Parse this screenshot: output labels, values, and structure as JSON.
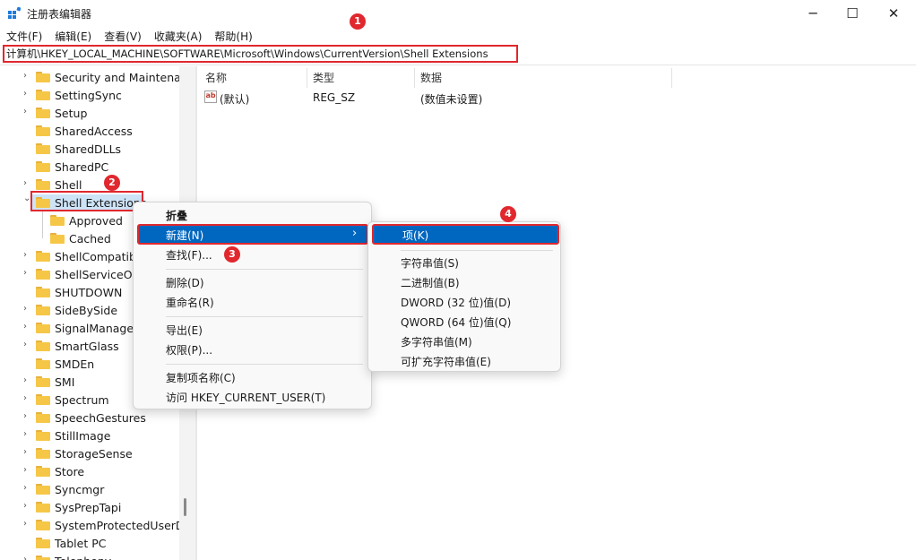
{
  "window": {
    "title": "注册表编辑器",
    "minimize_glyph": "─",
    "maximize_glyph": "☐",
    "close_glyph": "✕"
  },
  "menubar": [
    "文件(F)",
    "编辑(E)",
    "查看(V)",
    "收藏夹(A)",
    "帮助(H)"
  ],
  "address": "计算机\\HKEY_LOCAL_MACHINE\\SOFTWARE\\Microsoft\\Windows\\CurrentVersion\\Shell Extensions",
  "tree": [
    {
      "label": "Security and Maintenan",
      "expander": ">"
    },
    {
      "label": "SettingSync",
      "expander": ">"
    },
    {
      "label": "Setup",
      "expander": ">"
    },
    {
      "label": "SharedAccess",
      "expander": ""
    },
    {
      "label": "SharedDLLs",
      "expander": ""
    },
    {
      "label": "SharedPC",
      "expander": ""
    },
    {
      "label": "Shell",
      "expander": ">"
    },
    {
      "label": "Shell Extensions",
      "expander": "v",
      "selected": true
    },
    {
      "label": "Approved",
      "expander": "",
      "child": true
    },
    {
      "label": "Cached",
      "expander": "",
      "child": true
    },
    {
      "label": "ShellCompatibi",
      "expander": ">"
    },
    {
      "label": "ShellServiceOb",
      "expander": ">"
    },
    {
      "label": "SHUTDOWN",
      "expander": ""
    },
    {
      "label": "SideBySide",
      "expander": ">"
    },
    {
      "label": "SignalManager",
      "expander": ">"
    },
    {
      "label": "SmartGlass",
      "expander": ">"
    },
    {
      "label": "SMDEn",
      "expander": ""
    },
    {
      "label": "SMI",
      "expander": ">"
    },
    {
      "label": "Spectrum",
      "expander": ">"
    },
    {
      "label": "SpeechGestures",
      "expander": ">"
    },
    {
      "label": "StillImage",
      "expander": ">"
    },
    {
      "label": "StorageSense",
      "expander": ">"
    },
    {
      "label": "Store",
      "expander": ">"
    },
    {
      "label": "Syncmgr",
      "expander": ">"
    },
    {
      "label": "SysPrepTapi",
      "expander": ">"
    },
    {
      "label": "SystemProtectedUserDa",
      "expander": ">"
    },
    {
      "label": "Tablet PC",
      "expander": ""
    },
    {
      "label": "Telephony",
      "expander": ">"
    }
  ],
  "list": {
    "columns": [
      "名称",
      "类型",
      "数据"
    ],
    "rows": [
      {
        "icon": "ab",
        "name": "(默认)",
        "type": "REG_SZ",
        "data": "(数值未设置)"
      }
    ]
  },
  "context_menu": {
    "collapse": "折叠",
    "new": "新建(N)",
    "new_arrow": "›",
    "find": "查找(F)...",
    "delete": "删除(D)",
    "rename": "重命名(R)",
    "export": "导出(E)",
    "permissions": "权限(P)...",
    "copy_key_name": "复制项名称(C)",
    "goto_hkcu": "访问 HKEY_CURRENT_USER(T)"
  },
  "submenu": {
    "key": "项(K)",
    "string": "字符串值(S)",
    "binary": "二进制值(B)",
    "dword": "DWORD (32 位)值(D)",
    "qword": "QWORD (64 位)值(Q)",
    "multi_string": "多字符串值(M)",
    "expandable_string": "可扩充字符串值(E)"
  },
  "badges": [
    "1",
    "2",
    "3",
    "4"
  ],
  "colors": {
    "accent": "#0067c0",
    "annotation": "#e0282e",
    "folder": "#f6c747"
  }
}
